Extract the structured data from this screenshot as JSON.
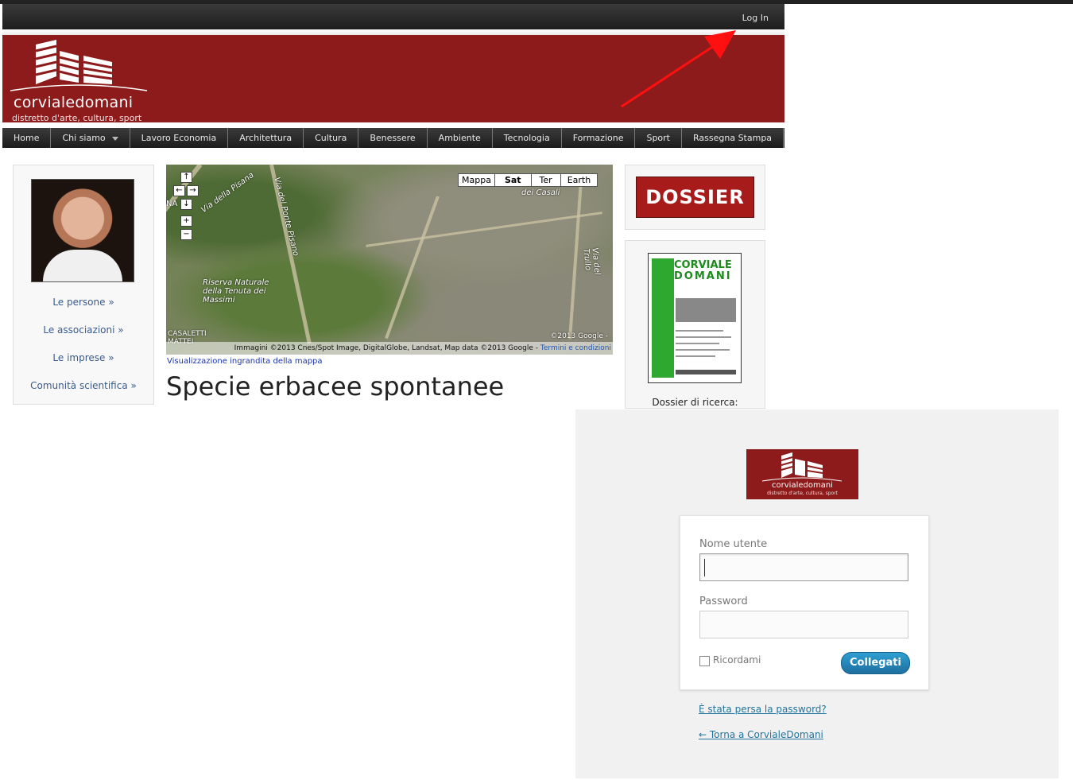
{
  "top_bar": {
    "login_label": "Log In"
  },
  "header": {
    "brand": "corvialedomani",
    "tagline": "distretto d'arte, cultura, sport"
  },
  "nav": {
    "items": [
      "Home",
      "Chi siamo",
      "Lavoro Economia",
      "Architettura",
      "Cultura",
      "Benessere",
      "Ambiente",
      "Tecnologia",
      "Formazione",
      "Sport",
      "Rassegna Stampa"
    ]
  },
  "sidebar": {
    "links": [
      "Le persone »",
      "Le associazioni »",
      "Le imprese »",
      "Comunità scientifica »"
    ]
  },
  "map": {
    "types": [
      "Mappa",
      "Sat",
      "Ter",
      "Earth"
    ],
    "selected_type": "Sat",
    "labels": {
      "pisana": "Via della Pisana",
      "ponte": "Via del Ponte Pisano",
      "casali": "dei Casali",
      "trullo": "Via del Trullo",
      "riserva": "Riserva Naturale della Tenuta dei Massimi",
      "casale": "CASALETTI MATTEI",
      "na": "NA"
    },
    "copyright": "©2013 Google -",
    "attribution": "Immagini ©2013 Cnes/Spot Image, DigitalGlobe, Landsat, Map data ©2013 Google -",
    "terms": "Termini e condizioni",
    "link": "Visualizzazione ingrandita della mappa"
  },
  "article": {
    "title": "Specie erbacee spontanee"
  },
  "right_sidebar": {
    "dossier_label": "DOSSIER",
    "cover_title_1": "CORVIALE",
    "cover_title_2": "DOMANI",
    "caption": "Dossier di ricerca:"
  },
  "login": {
    "logo_brand": "corvialedomani",
    "logo_tagline": "distretto d'arte, cultura, sport",
    "username_label": "Nome utente",
    "username_value": "",
    "password_label": "Password",
    "password_value": "",
    "remember_label": "Ricordami",
    "remember_checked": false,
    "submit_label": "Collegati",
    "lost_password": "È stata persa la password?",
    "back_link": "← Torna a CorvialeDomani"
  },
  "colors": {
    "brand_red": "#8d1b1b",
    "button_blue": "#2e8fc4",
    "link_blue": "#21759b",
    "annotation_arrow": "#ff1010"
  }
}
